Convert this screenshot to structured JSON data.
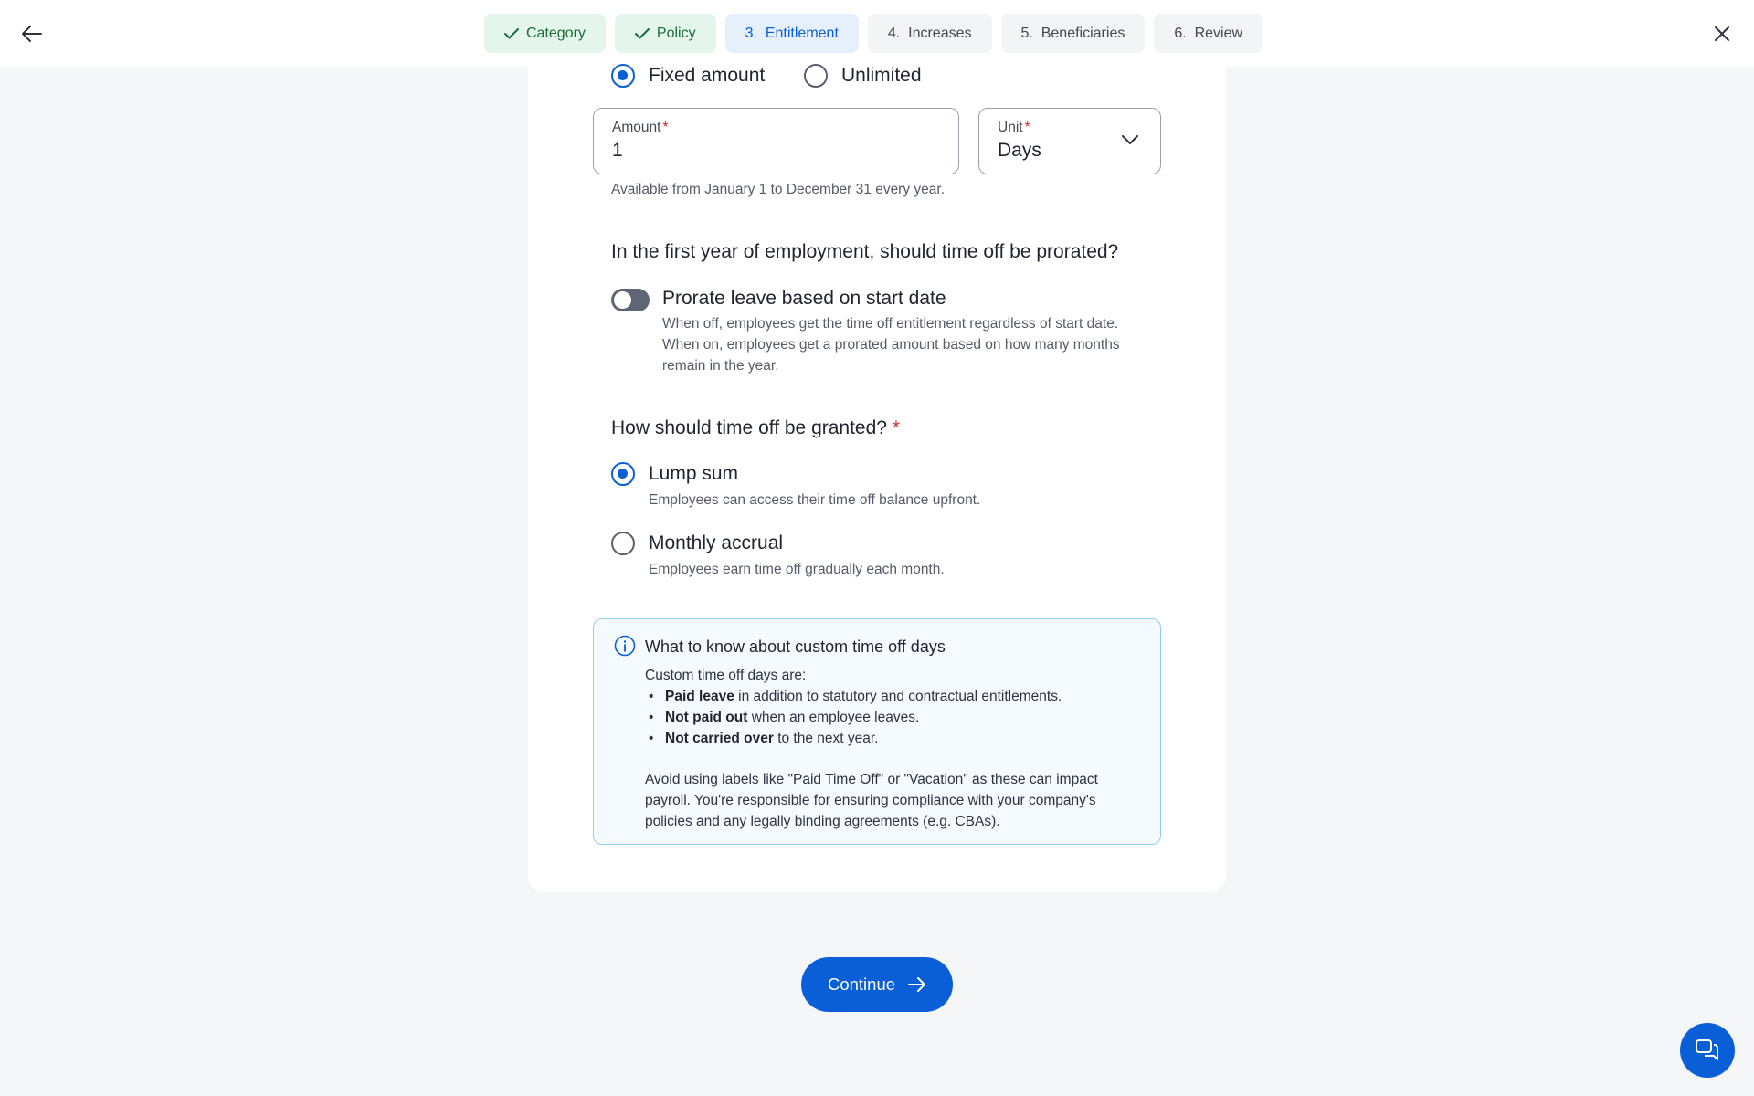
{
  "nav": {
    "steps": [
      {
        "label": "Category",
        "state": "done"
      },
      {
        "label": "Policy",
        "state": "done"
      },
      {
        "label": "3.  Entitlement",
        "state": "current"
      },
      {
        "label": "4.  Increases",
        "state": "todo"
      },
      {
        "label": "5.  Beneficiaries",
        "state": "todo"
      },
      {
        "label": "6.  Review",
        "state": "todo"
      }
    ],
    "back_icon": "arrow-left-icon",
    "close_icon": "close-icon"
  },
  "entitlement_type": {
    "options": [
      {
        "label": "Fixed amount",
        "selected": true
      },
      {
        "label": "Unlimited",
        "selected": false
      }
    ]
  },
  "amount_field": {
    "label": "Amount",
    "required_mark": "*",
    "value": "1"
  },
  "unit_field": {
    "label": "Unit",
    "required_mark": "*",
    "value": "Days"
  },
  "availability_note": "Available from January 1 to December 31 every year.",
  "proration": {
    "question": "In the first year of employment, should time off be prorated?",
    "toggle_label": "Prorate leave based on start date",
    "toggle_on": false,
    "description": "When off, employees get the time off entitlement regardless of start date. When on, employees get a prorated amount based on how many months remain in the year."
  },
  "grant": {
    "question": "How should time off be granted?",
    "required_mark": "*",
    "options": [
      {
        "label": "Lump sum",
        "description": "Employees can access their time off balance upfront.",
        "selected": true
      },
      {
        "label": "Monthly accrual",
        "description": "Employees earn time off gradually each month.",
        "selected": false
      }
    ]
  },
  "info_box": {
    "title": "What to know about custom time off days",
    "intro": "Custom time off days are:",
    "bullets": [
      {
        "bold": "Paid leave",
        "rest": " in addition to statutory and contractual entitlements."
      },
      {
        "bold": "Not paid out",
        "rest": " when an employee leaves."
      },
      {
        "bold": "Not carried over",
        "rest": " to the next year."
      }
    ],
    "note": "Avoid using labels like \"Paid Time Off\" or \"Vacation\" as these can impact payroll. You're responsible for ensuring compliance with your company's policies and any legally binding agreements (e.g. CBAs)."
  },
  "continue_label": "Continue",
  "colors": {
    "primary": "#0b5fd6",
    "done_bg": "#e4f6ec",
    "current_bg": "#e5f0fc",
    "required": "#d62828"
  }
}
